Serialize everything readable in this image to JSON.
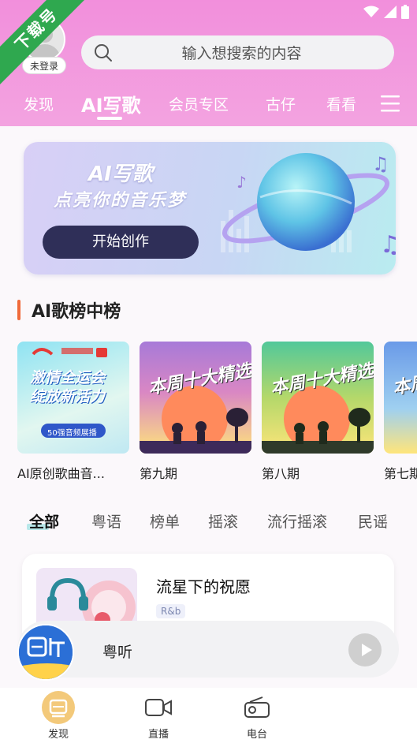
{
  "ribbon_text": "下载号",
  "header": {
    "login_label": "未登录",
    "search_placeholder": "输入想搜索的内容",
    "tabs": [
      {
        "label": "发现"
      },
      {
        "label": "AI写歌"
      },
      {
        "label": "会员专区"
      },
      {
        "label": "古仔"
      },
      {
        "label": "看看"
      }
    ]
  },
  "banner": {
    "title": "AI写歌",
    "subtitle": "点亮你的音乐梦",
    "button_label": "开始创作"
  },
  "section": {
    "title": "AI歌榜中榜"
  },
  "cards": [
    {
      "label": "AI原创歌曲音...",
      "art_text": "激情全运会 绽放新活力",
      "art_sub": "50强音频展播"
    },
    {
      "label": "第九期",
      "art_text": "本周十大精选"
    },
    {
      "label": "第八期",
      "art_text": "本周十大精选"
    },
    {
      "label": "第七期",
      "art_text": "本周十大精选"
    }
  ],
  "categories": [
    {
      "label": "全部"
    },
    {
      "label": "粤语"
    },
    {
      "label": "榜单"
    },
    {
      "label": "摇滚"
    },
    {
      "label": "流行摇滚"
    },
    {
      "label": "民谣"
    }
  ],
  "song": {
    "title": "流星下的祝愿",
    "tag": "R&b"
  },
  "player": {
    "name": "粤听"
  },
  "bottom_nav": [
    {
      "label": "发现"
    },
    {
      "label": "直播"
    },
    {
      "label": "电台"
    }
  ],
  "colors": {
    "header_pink": "#f28fdc",
    "ribbon_green": "#2fa84f",
    "section_accent": "#f06a3a",
    "banner_button": "#2f2f58"
  }
}
